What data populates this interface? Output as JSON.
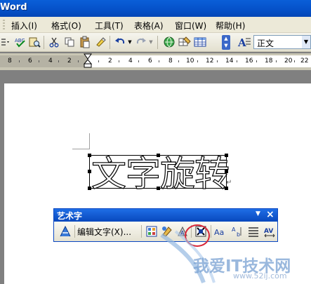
{
  "window": {
    "title_fragment": "Word"
  },
  "menubar": {
    "items": [
      {
        "label": "插入(I)"
      },
      {
        "label": "格式(O)"
      },
      {
        "label": "工具(T)"
      },
      {
        "label": "表格(A)"
      },
      {
        "label": "窗口(W)"
      },
      {
        "label": "帮助(H)"
      }
    ]
  },
  "toolbar": {
    "style_value": "正文",
    "icons": [
      "style-icon",
      "spell-check-icon",
      "research-icon",
      "cut-icon",
      "copy-icon",
      "paste-icon",
      "format-painter-icon",
      "undo-icon",
      "redo-icon",
      "hyperlink-icon",
      "tables-borders-icon",
      "insert-table-icon",
      "styles-formatting-icon"
    ]
  },
  "ruler": {
    "left_numbers": [
      "8",
      "6",
      "4",
      "2"
    ],
    "right_numbers": [
      "2",
      "4",
      "6",
      "8",
      "10",
      "12",
      "14",
      "16",
      "18",
      "20",
      "22"
    ]
  },
  "document": {
    "wordart_text": "文字旋转",
    "paragraph_mark": "↵"
  },
  "wordart_toolbar": {
    "title": "艺术字",
    "edit_text_label": "编辑文字(X)...",
    "icons": [
      "insert-wordart-icon",
      "wordart-gallery-icon",
      "format-wordart-icon",
      "wordart-shape-icon",
      "text-wrapping-icon",
      "same-letter-heights-icon",
      "vertical-text-icon",
      "alignment-icon",
      "character-spacing-icon"
    ],
    "highlight_color": "#d8283a"
  },
  "watermark": {
    "text": "我爱IT技术网",
    "url": "www.52ij.com"
  }
}
